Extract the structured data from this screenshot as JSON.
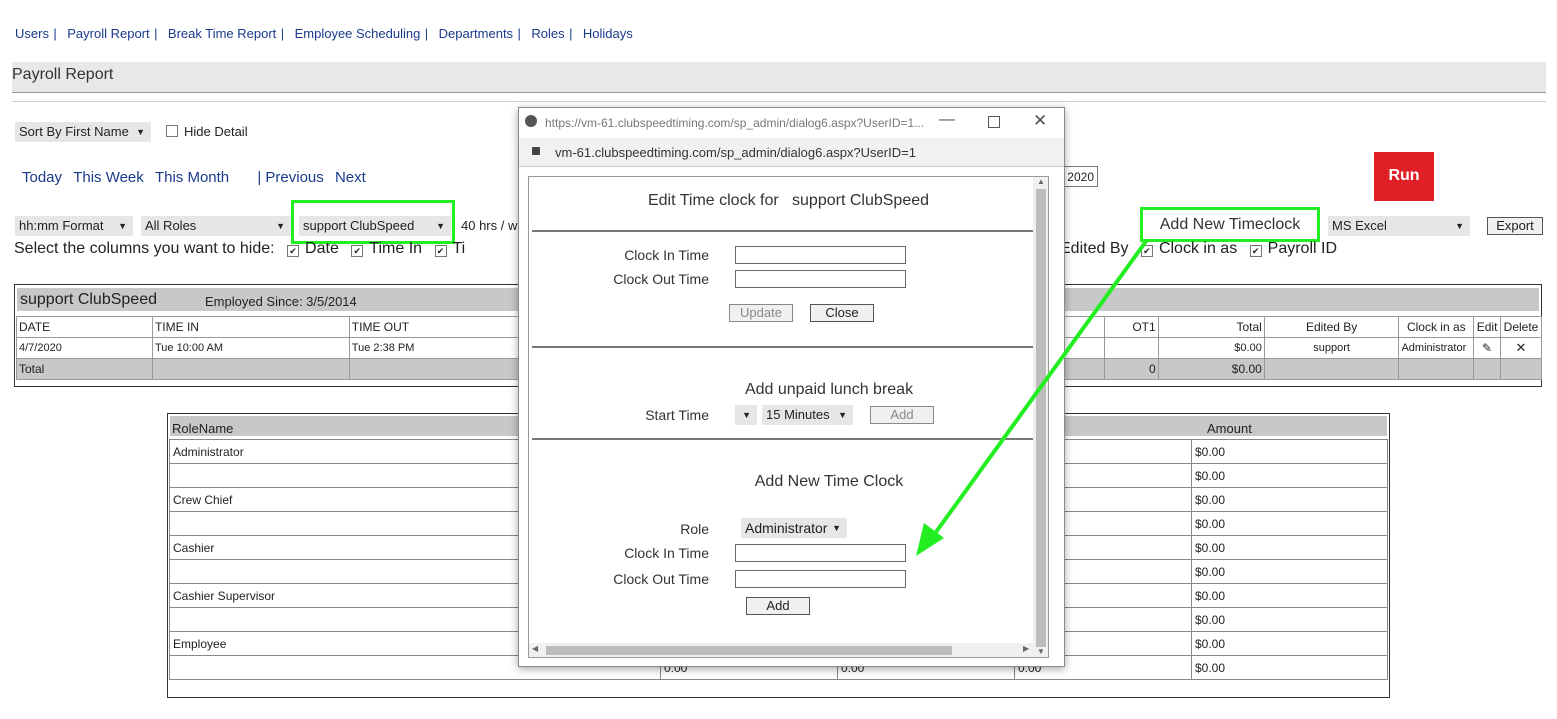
{
  "nav": {
    "items": [
      "Users",
      "Payroll Report",
      "Break Time Report",
      "Employee Scheduling",
      "Departments",
      "Roles",
      "Holidays"
    ],
    "sep": "|"
  },
  "page_title": "Payroll Report",
  "filters": {
    "sort_by": "Sort By First Name",
    "hide_detail": "Hide Detail",
    "today": "Today",
    "this_week": "This Week",
    "this_month": "This Month",
    "previous": "| Previous",
    "next": "Next",
    "date_end_fragment": "2020",
    "run": "Run",
    "format": "hh:mm Format",
    "roles": "All Roles",
    "employee": "support ClubSpeed",
    "hours_fragment": "40 hrs / w",
    "export_format": "MS Excel",
    "export": "Export",
    "annotation": "Add New Timeclock"
  },
  "columns_hide": {
    "label": "Select the columns you want to hide:",
    "left": [
      "Date",
      "Time In",
      "Ti"
    ],
    "right_fragment": "Edited By",
    "right": [
      "Clock in as",
      "Payroll ID"
    ]
  },
  "employee_table": {
    "name": "support ClubSpeed",
    "employed_since": "Employed Since: 3/5/2014",
    "headers": [
      "DATE",
      "TIME IN",
      "TIME OUT",
      "OT1",
      "Total",
      "Edited By",
      "Clock in as",
      "Edit",
      "Delete"
    ],
    "row": {
      "date": "4/7/2020",
      "time_in": "Tue 10:00 AM",
      "time_out": "Tue 2:38 PM",
      "total": "$0.00",
      "edited_by": "support",
      "clock_in_as": "Administrator"
    },
    "total_label": "Total",
    "total_ot1": "0",
    "total_amount": "$0.00"
  },
  "roles_table": {
    "header_role": "RoleName",
    "header_amount": "Amount",
    "roles": [
      {
        "name": "Administrator",
        "amount1": "$0.00",
        "amount2": "$0.00"
      },
      {
        "name": "Crew Chief",
        "amount1": "$0.00",
        "amount2": "$0.00"
      },
      {
        "name": "Cashier",
        "amount1": "$0.00",
        "amount2": "$0.00"
      },
      {
        "name": "Cashier Supervisor",
        "amount1": "$0.00",
        "amount2": "$0.00"
      },
      {
        "name": "Employee",
        "amount1": "$0.00",
        "amount2": "$0.00"
      }
    ],
    "last_row_values": [
      "0.00",
      "0.00",
      "0.00"
    ]
  },
  "dialog": {
    "title_url": "https://vm-61.clubspeedtiming.com/sp_admin/dialog6.aspx?UserID=1...",
    "address": "vm-61.clubspeedtiming.com/sp_admin/dialog6.aspx?UserID=1",
    "edit_title": "Edit Time clock for   support ClubSpeed",
    "clock_in": "Clock In Time",
    "clock_out": "Clock Out Time",
    "update": "Update",
    "close": "Close",
    "lunch_title": "Add unpaid lunch break",
    "start_time": "Start Time",
    "duration": "15 Minutes",
    "add": "Add",
    "new_title": "Add New Time Clock",
    "role_label": "Role",
    "role_value": "Administrator",
    "clock_in2": "Clock In Time",
    "clock_out2": "Clock Out Time",
    "add2": "Add"
  },
  "colors": {
    "accent_green": "#22ee22",
    "run_red": "#e02027",
    "link": "#1a3a8c"
  }
}
